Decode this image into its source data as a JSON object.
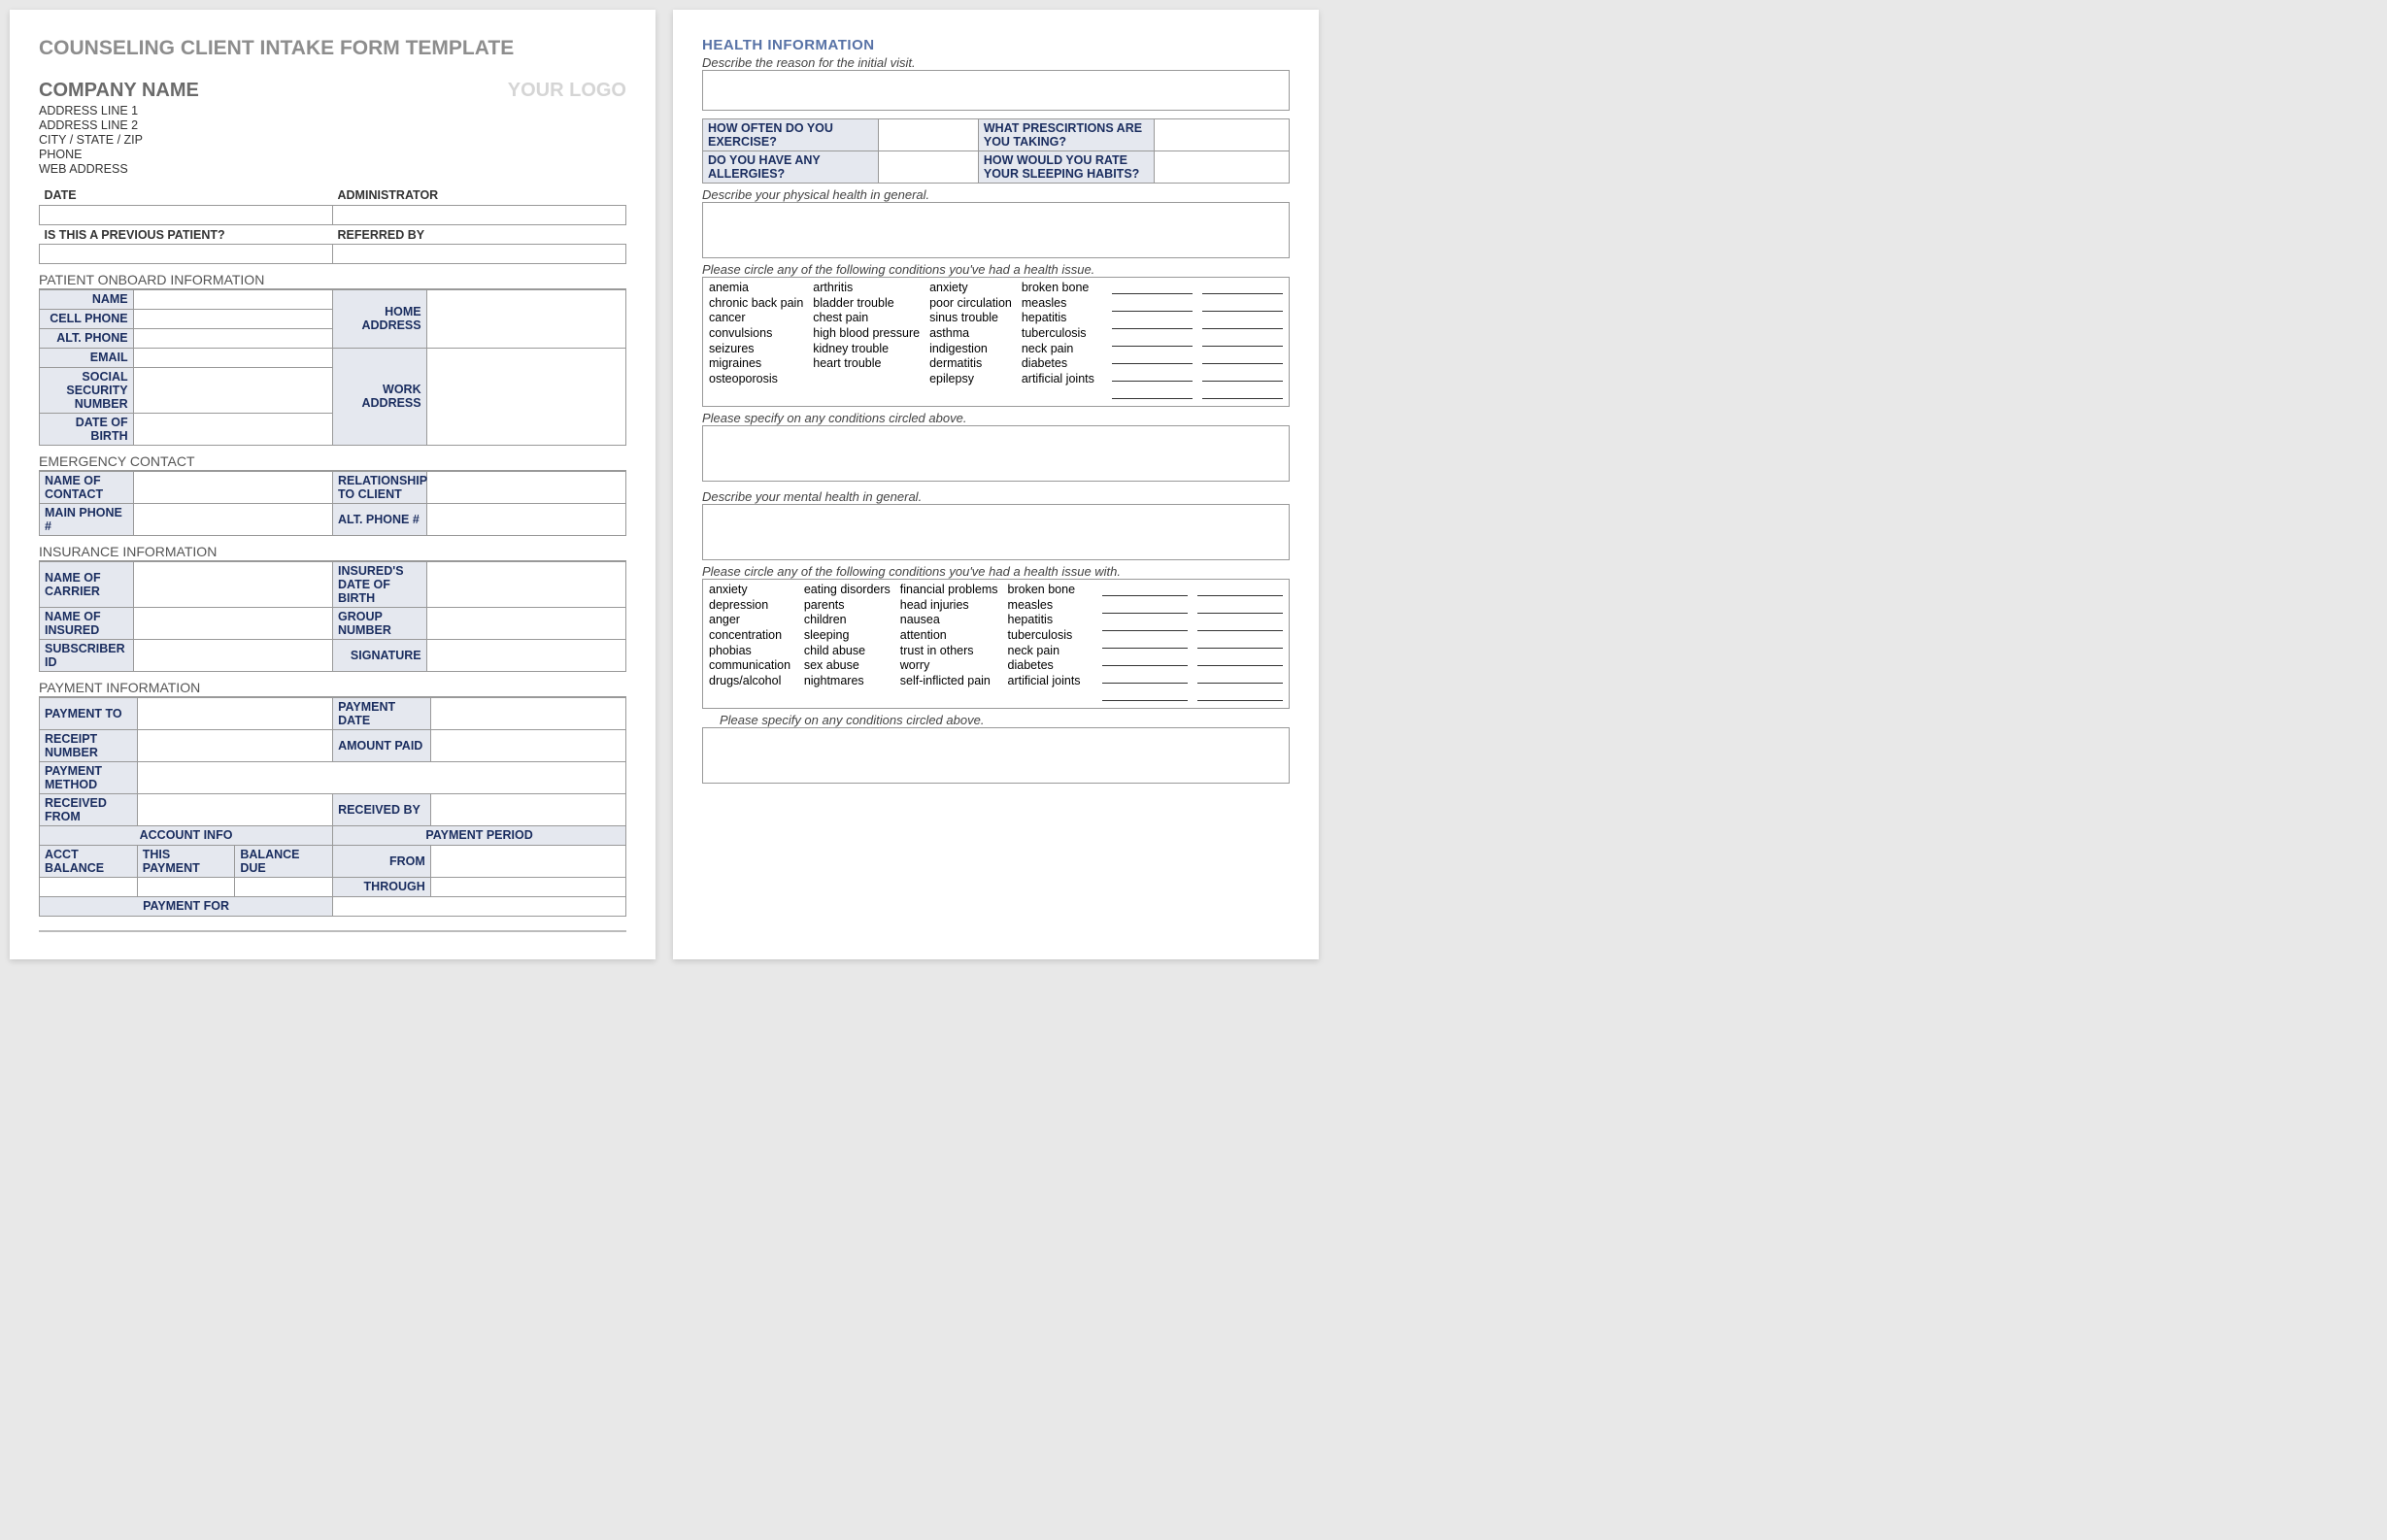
{
  "docTitle": "COUNSELING CLIENT INTAKE FORM TEMPLATE",
  "company": {
    "name": "COMPANY NAME",
    "logo": "YOUR LOGO",
    "addr1": "ADDRESS LINE 1",
    "addr2": "ADDRESS LINE 2",
    "csz": "CITY / STATE / ZIP",
    "phone": "PHONE",
    "web": "WEB ADDRESS"
  },
  "top": {
    "date": "DATE",
    "admin": "ADMINISTRATOR",
    "prevPatient": "IS THIS A PREVIOUS PATIENT?",
    "referred": "REFERRED BY"
  },
  "sections": {
    "onboard": "PATIENT ONBOARD INFORMATION",
    "emergency": "EMERGENCY CONTACT",
    "insurance": "INSURANCE INFORMATION",
    "payment": "PAYMENT INFORMATION",
    "health": "HEALTH INFORMATION"
  },
  "onboard": {
    "name": "NAME",
    "cell": "CELL PHONE",
    "alt": "ALT. PHONE",
    "email": "EMAIL",
    "ssn": "SOCIAL SECURITY NUMBER",
    "dob": "DATE OF BIRTH",
    "homeAddr": "HOME ADDRESS",
    "workAddr": "WORK ADDRESS"
  },
  "emergency": {
    "nameContact": "NAME OF CONTACT",
    "relationship": "RELATIONSHIP TO CLIENT",
    "mainPhone": "MAIN PHONE #",
    "altPhone": "ALT. PHONE #"
  },
  "insurance": {
    "carrier": "NAME OF CARRIER",
    "insuredDob": "INSURED'S DATE OF BIRTH",
    "insured": "NAME OF INSURED",
    "groupNum": "GROUP NUMBER",
    "subId": "SUBSCRIBER ID",
    "signature": "SIGNATURE"
  },
  "payment": {
    "paymentTo": "PAYMENT TO",
    "paymentDate": "PAYMENT DATE",
    "receiptNum": "RECEIPT NUMBER",
    "amountPaid": "AMOUNT PAID",
    "paymentMethod": "PAYMENT METHOD",
    "receivedFrom": "RECEIVED FROM",
    "receivedBy": "RECEIVED BY",
    "acctInfo": "ACCOUNT INFO",
    "paymentPeriod": "PAYMENT PERIOD",
    "acctBalance": "ACCT BALANCE",
    "thisPayment": "THIS PAYMENT",
    "balanceDue": "BALANCE DUE",
    "from": "FROM",
    "through": "THROUGH",
    "paymentFor": "PAYMENT FOR"
  },
  "health": {
    "initVisit": "Describe the reason for the initial visit.",
    "exercise": "HOW OFTEN DO YOU EXERCISE?",
    "prescriptions": "WHAT PRESCIRTIONS ARE YOU TAKING?",
    "allergies": "DO YOU HAVE ANY ALLERGIES?",
    "sleep": "HOW WOULD YOU RATE YOUR SLEEPING HABITS?",
    "physHealth": "Describe your physical health in general.",
    "circleCond1": "Please circle any of the following conditions you've had a health issue.",
    "specifyCond": "Please specify on any conditions circled above.",
    "mentalHealth": "Describe your mental health in general.",
    "circleCond2": "Please circle any of the following conditions you've had a health issue with."
  },
  "physCond": {
    "c1": [
      "anemia",
      "chronic back pain",
      "cancer",
      "convulsions",
      "seizures",
      "migraines",
      "osteoporosis"
    ],
    "c2": [
      "arthritis",
      "bladder trouble",
      "chest pain",
      "high blood pressure",
      "kidney trouble",
      "heart trouble"
    ],
    "c3": [
      "anxiety",
      "poor circulation",
      "sinus trouble",
      "asthma",
      "indigestion",
      "dermatitis",
      "epilepsy"
    ],
    "c4": [
      "broken bone",
      "measles",
      "hepatitis",
      "tuberculosis",
      "neck pain",
      "diabetes",
      "artificial joints"
    ]
  },
  "mentCond": {
    "c1": [
      "anxiety",
      "depression",
      "anger",
      "concentration",
      "phobias",
      "communication",
      "drugs/alcohol"
    ],
    "c2": [
      "eating disorders",
      "parents",
      "children",
      "sleeping",
      "child abuse",
      "sex abuse",
      "nightmares"
    ],
    "c3": [
      "financial problems",
      "head injuries",
      "nausea",
      "attention",
      "trust in others",
      "worry",
      "self-inflicted pain"
    ],
    "c4": [
      "broken bone",
      "measles",
      "hepatitis",
      "tuberculosis",
      "neck pain",
      "diabetes",
      "artificial joints"
    ]
  }
}
